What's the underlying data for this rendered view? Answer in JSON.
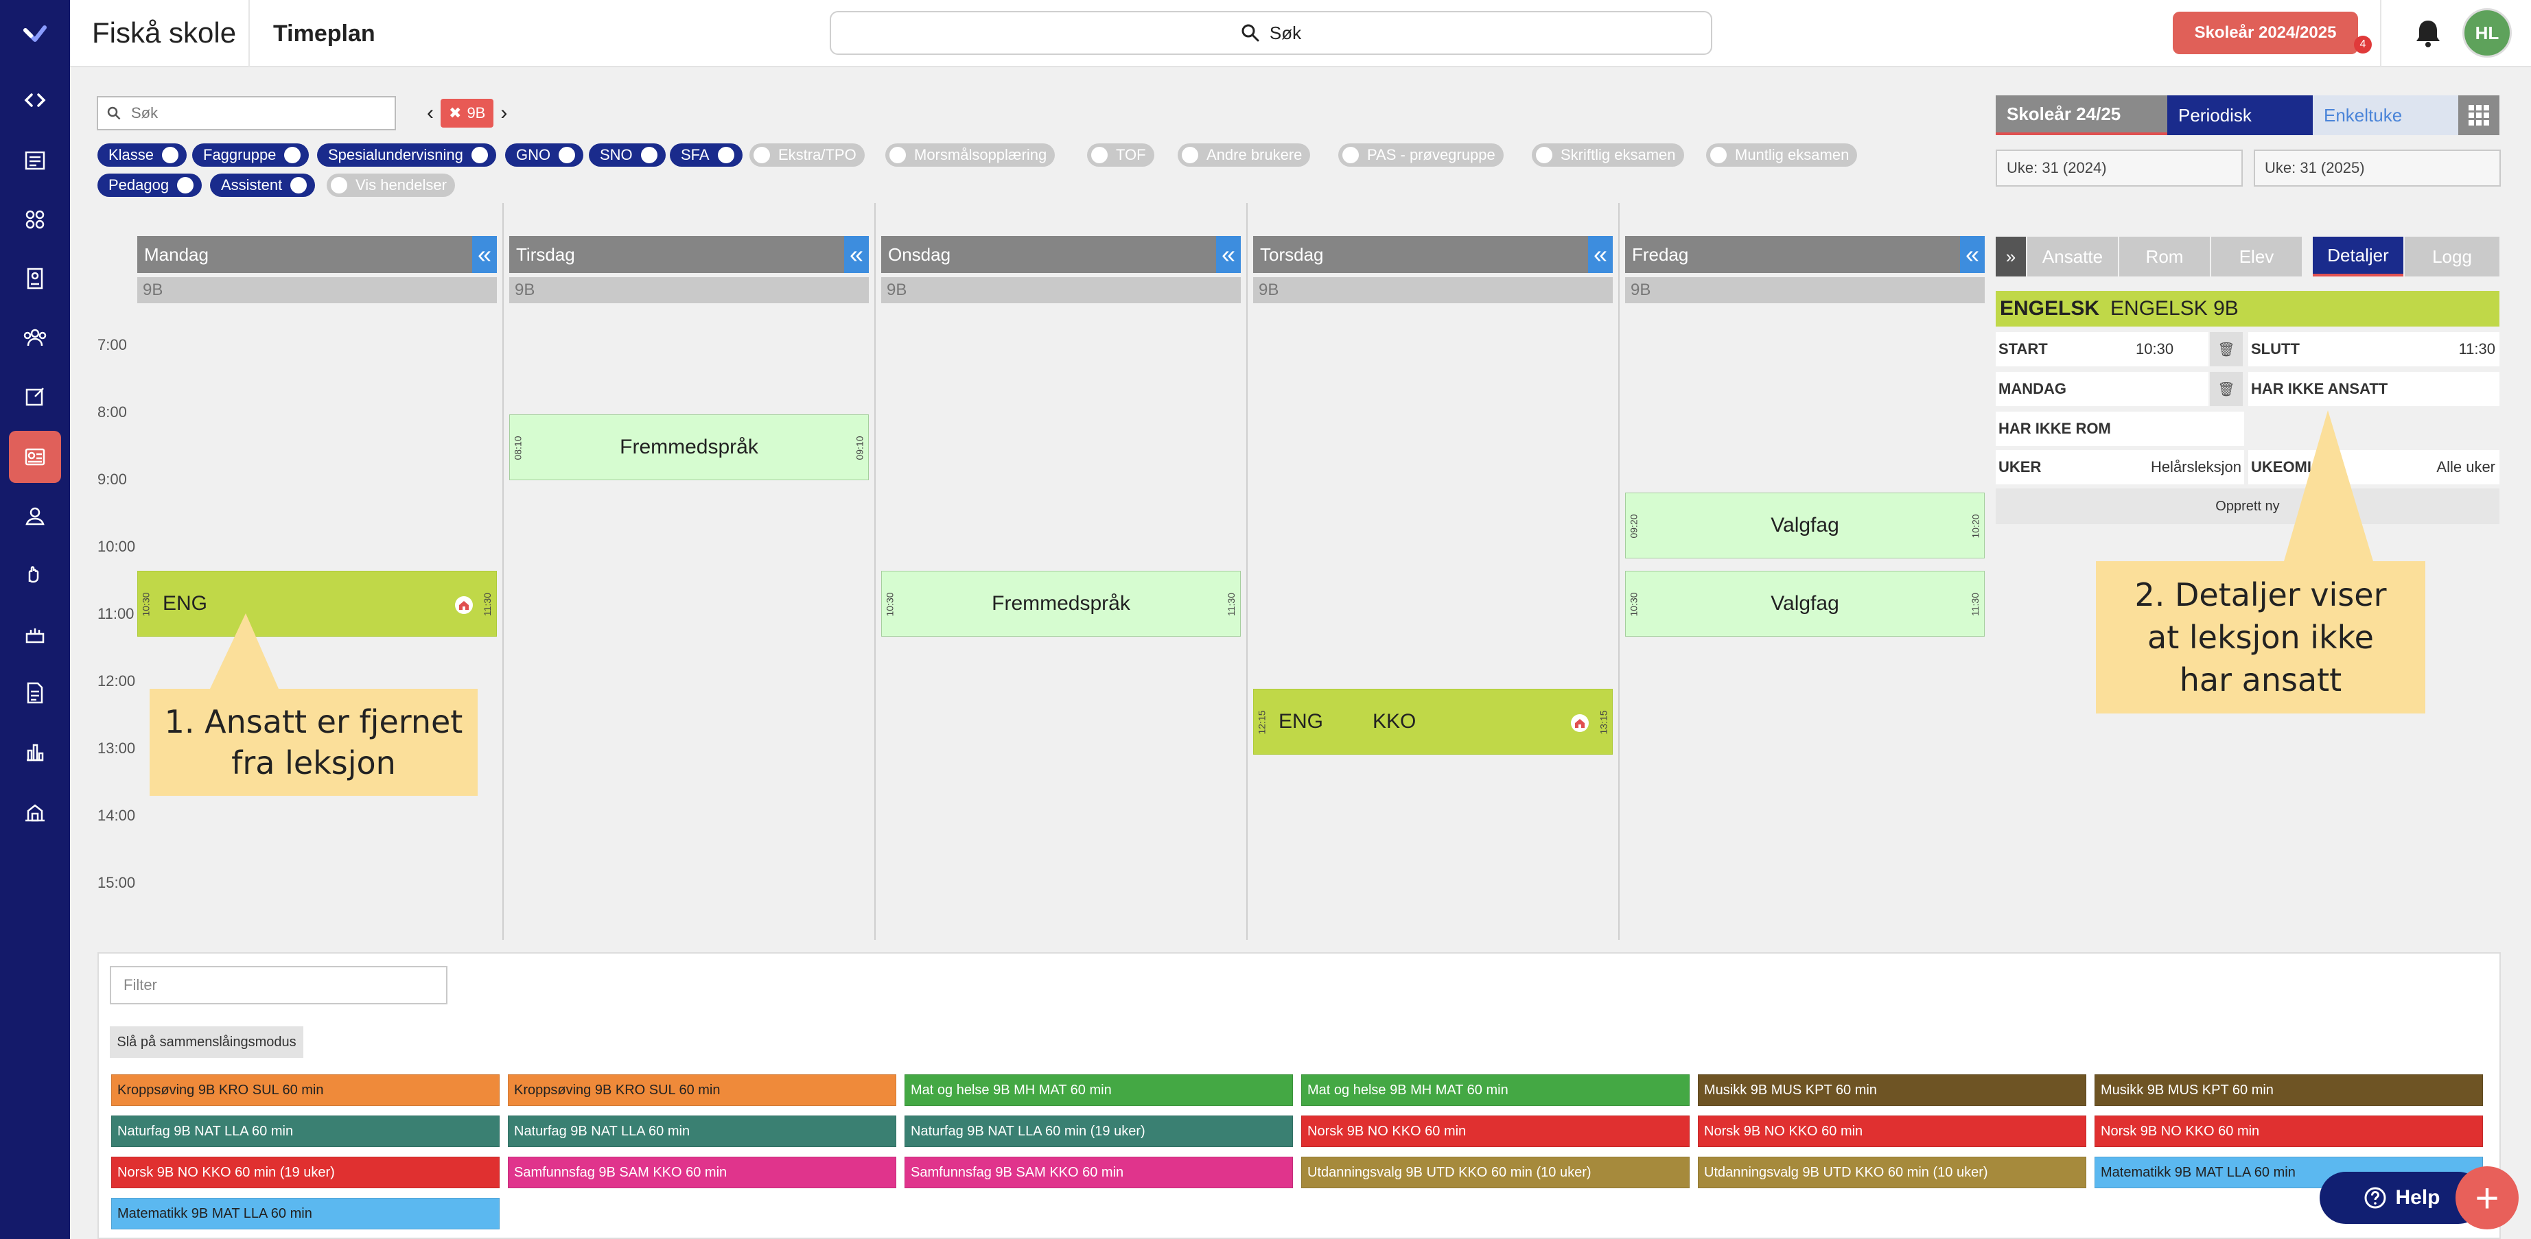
{
  "header": {
    "school_name": "Fiskå skole",
    "page_title": "Timeplan",
    "search_label": "Søk",
    "school_year_button": "Skoleår 2024/2025",
    "notification_count": "4",
    "avatar_initials": "HL"
  },
  "filters": {
    "search_placeholder": "Søk",
    "class_tag": "9B",
    "toggles_on": [
      "Klasse",
      "Faggruppe",
      "Spesialundervisning",
      "GNO",
      "SNO",
      "SFA",
      "Pedagog",
      "Assistent"
    ],
    "toggles_off": [
      "Ekstra/TPO",
      "Morsmålsopplæring",
      "TOF",
      "Andre brukere",
      "PAS - prøvegruppe",
      "Skriftlig eksamen",
      "Muntlig eksamen",
      "Vis hendelser"
    ]
  },
  "calendar": {
    "days": [
      "Mandag",
      "Tirsdag",
      "Onsdag",
      "Torsdag",
      "Fredag"
    ],
    "class_label": "9B",
    "collapse_glyph": "«",
    "times": [
      "7:00",
      "8:00",
      "9:00",
      "10:00",
      "11:00",
      "12:00",
      "13:00",
      "14:00",
      "15:00"
    ],
    "lessons": {
      "mon_eng": {
        "label": "ENG",
        "start": "10:30",
        "end": "11:30"
      },
      "tue_fremmed": {
        "label": "Fremmedspråk",
        "start": "08:10",
        "end": "09:10"
      },
      "wed_fremmed": {
        "label": "Fremmedspråk",
        "start": "10:30",
        "end": "11:30"
      },
      "thu_eng": {
        "label": "ENG",
        "teacher": "KKO",
        "start": "12:15",
        "end": "13:15"
      },
      "fri_valg1": {
        "label": "Valgfag",
        "start": "09:20",
        "end": "10:20"
      },
      "fri_valg2": {
        "label": "Valgfag",
        "start": "10:30",
        "end": "11:30"
      }
    }
  },
  "callouts": {
    "one": "1. Ansatt er fjernet fra leksjon",
    "two": "2. Detaljer viser at leksjon ikke har ansatt"
  },
  "right_panel": {
    "tabs": [
      "Skoleår 24/25",
      "Periodisk",
      "Enkeltuke"
    ],
    "week_start": "Uke: 31 (2024)",
    "week_end": "Uke: 31 (2025)",
    "detail_tabs": [
      "Ansatte",
      "Rom",
      "Elev",
      "Detaljer",
      "Logg"
    ],
    "expand_glyph": "»",
    "title_code": "ENGELSK",
    "title_name": "ENGELSK 9B",
    "start_label": "START",
    "start_value": "10:30",
    "slutt_label": "SLUTT",
    "slutt_value": "11:30",
    "day_label": "MANDAG",
    "no_staff": "HAR IKKE ANSATT",
    "no_room": "HAR IKKE ROM",
    "weeks_label": "UKER",
    "weeks_value": "Helårsleksjon",
    "rotation_label": "UKEOMLØP",
    "rotation_value": "Alle uker",
    "create_new": "Opprett ny"
  },
  "bottom": {
    "filter_placeholder": "Filter",
    "merge_button": "Slå på sammenslåingsmodus",
    "subjects": [
      {
        "label": "Kroppsøving 9B KRO SUL 60 min",
        "color": "#ef8a3a",
        "text": "#222"
      },
      {
        "label": "Kroppsøving 9B KRO SUL 60 min",
        "color": "#ef8a3a",
        "text": "#222"
      },
      {
        "label": "Mat og helse 9B MH MAT 60 min",
        "color": "#44a844",
        "text": "#fff"
      },
      {
        "label": "Mat og helse 9B MH MAT 60 min",
        "color": "#44a844",
        "text": "#fff"
      },
      {
        "label": "Musikk 9B MUS KPT 60 min",
        "color": "#6e5424",
        "text": "#fff"
      },
      {
        "label": "Musikk 9B MUS KPT 60 min",
        "color": "#6e5424",
        "text": "#fff"
      },
      {
        "label": "Naturfag 9B NAT LLA 60 min",
        "color": "#3a8072",
        "text": "#fff"
      },
      {
        "label": "Naturfag 9B NAT LLA 60 min",
        "color": "#3a8072",
        "text": "#fff"
      },
      {
        "label": "Naturfag 9B NAT LLA 60 min (19 uker)",
        "color": "#3a8072",
        "text": "#fff"
      },
      {
        "label": "Norsk 9B NO KKO 60 min",
        "color": "#e03030",
        "text": "#fff"
      },
      {
        "label": "Norsk 9B NO KKO 60 min",
        "color": "#e03030",
        "text": "#fff"
      },
      {
        "label": "Norsk 9B NO KKO 60 min",
        "color": "#e03030",
        "text": "#fff"
      },
      {
        "label": "Norsk 9B NO KKO 60 min (19 uker)",
        "color": "#e03030",
        "text": "#fff"
      },
      {
        "label": "Samfunnsfag 9B SAM KKO 60 min",
        "color": "#e0348c",
        "text": "#fff"
      },
      {
        "label": "Samfunnsfag 9B SAM KKO 60 min",
        "color": "#e0348c",
        "text": "#fff"
      },
      {
        "label": "Utdanningsvalg 9B UTD KKO 60 min (10 uker)",
        "color": "#a68a3c",
        "text": "#fff"
      },
      {
        "label": "Utdanningsvalg 9B UTD KKO 60 min (10 uker)",
        "color": "#a68a3c",
        "text": "#fff"
      },
      {
        "label": "Matematikk 9B MAT LLA 60 min",
        "color": "#5bb8f0",
        "text": "#222"
      },
      {
        "label": "Matematikk 9B MAT LLA 60 min",
        "color": "#5bb8f0",
        "text": "#222"
      }
    ]
  },
  "help_button": "Help",
  "fab_glyph": "+"
}
